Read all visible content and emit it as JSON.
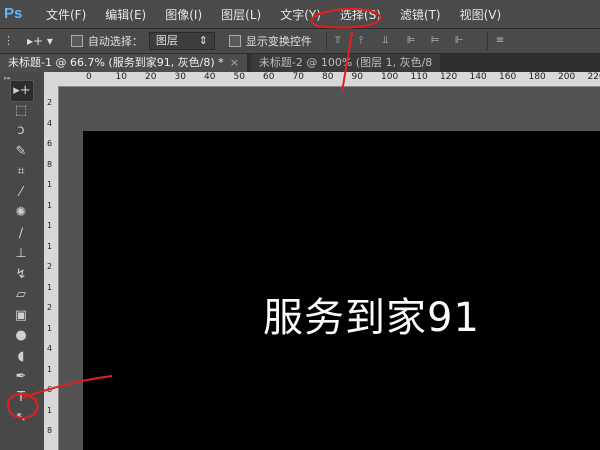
{
  "app": {
    "logo": "Ps"
  },
  "menu": [
    "文件(F)",
    "编辑(E)",
    "图像(I)",
    "图层(L)",
    "文字(Y)",
    "选择(S)",
    "滤镜(T)",
    "视图(V)"
  ],
  "options": {
    "auto_select_label": "自动选择：",
    "layer_select": "图层",
    "transform_controls_label": "显示变换控件"
  },
  "tabs": [
    {
      "title": "未标题-1 @ 66.7% (服务到家91, 灰色/8) *",
      "close": "×",
      "active": true
    },
    {
      "title": "未标题-2 @ 100% (图层 1, 灰色/8",
      "active": false
    }
  ],
  "ruler_top": [
    "0",
    "10",
    "20",
    "30",
    "40",
    "50",
    "60",
    "70",
    "80",
    "90",
    "100",
    "110",
    "120",
    "140",
    "160",
    "180",
    "200",
    "220"
  ],
  "ruler_left": [
    "2",
    "4",
    "6",
    "8",
    "1",
    "1",
    "1",
    "1",
    "2",
    "1",
    "2",
    "1",
    "4",
    "1",
    "6",
    "1",
    "8"
  ],
  "tools": [
    {
      "name": "move-tool-icon",
      "glyph": "▸+"
    },
    {
      "name": "marquee-tool-icon",
      "glyph": "⬚"
    },
    {
      "name": "lasso-tool-icon",
      "glyph": "ↄ"
    },
    {
      "name": "quick-select-tool-icon",
      "glyph": "✎"
    },
    {
      "name": "crop-tool-icon",
      "glyph": "⌗"
    },
    {
      "name": "eyedropper-tool-icon",
      "glyph": "⁄"
    },
    {
      "name": "healing-brush-tool-icon",
      "glyph": "✺"
    },
    {
      "name": "brush-tool-icon",
      "glyph": "∕"
    },
    {
      "name": "clone-stamp-tool-icon",
      "glyph": "⊥"
    },
    {
      "name": "history-brush-tool-icon",
      "glyph": "↯"
    },
    {
      "name": "eraser-tool-icon",
      "glyph": "▱"
    },
    {
      "name": "gradient-tool-icon",
      "glyph": "▣"
    },
    {
      "name": "blur-tool-icon",
      "glyph": "●"
    },
    {
      "name": "dodge-tool-icon",
      "glyph": "◖"
    },
    {
      "name": "pen-tool-icon",
      "glyph": "✒"
    },
    {
      "name": "type-tool-icon",
      "glyph": "T"
    },
    {
      "name": "path-select-tool-icon",
      "glyph": "↖"
    }
  ],
  "canvas_text": "服务到家91",
  "colors": {
    "accent_logo": "#5fb6ff",
    "annotation": "#e02020"
  }
}
